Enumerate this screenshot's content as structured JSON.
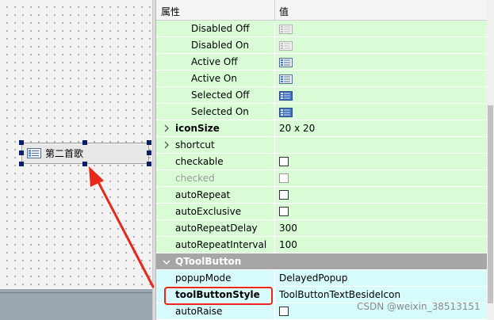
{
  "canvas": {
    "tool_button_label": "第二首歌"
  },
  "property_editor": {
    "header_property": "属性",
    "header_value": "值",
    "rows": [
      {
        "name": "Disabled Off",
        "value_type": "pixmap"
      },
      {
        "name": "Disabled On",
        "value_type": "pixmap"
      },
      {
        "name": "Active Off",
        "value_type": "pixmap"
      },
      {
        "name": "Active On",
        "value_type": "pixmap"
      },
      {
        "name": "Selected Off",
        "value_type": "pixmap"
      },
      {
        "name": "Selected On",
        "value_type": "pixmap"
      },
      {
        "name": "iconSize",
        "value": "20 x 20"
      },
      {
        "name": "shortcut",
        "value": ""
      },
      {
        "name": "checkable",
        "value_type": "checkbox"
      },
      {
        "name": "checked",
        "value_type": "checkbox",
        "disabled": true
      },
      {
        "name": "autoRepeat",
        "value_type": "checkbox"
      },
      {
        "name": "autoExclusive",
        "value_type": "checkbox"
      },
      {
        "name": "autoRepeatDelay",
        "value": "300"
      },
      {
        "name": "autoRepeatInterval",
        "value": "100"
      },
      {
        "name": "QToolButton",
        "group": true
      },
      {
        "name": "popupMode",
        "value": "DelayedPopup"
      },
      {
        "name": "toolButtonStyle",
        "value": "ToolButtonTextBesideIcon"
      },
      {
        "name": "autoRaise",
        "value_type": "checkbox"
      }
    ]
  },
  "colors": {
    "highlight": "#e8261a",
    "row_green": "#d9fcd7",
    "row_cyan": "#d7fbfc",
    "group_row": "#a6a6a6",
    "handle": "#0a1e6e"
  },
  "watermark": "CSDN @weixin_38513151"
}
